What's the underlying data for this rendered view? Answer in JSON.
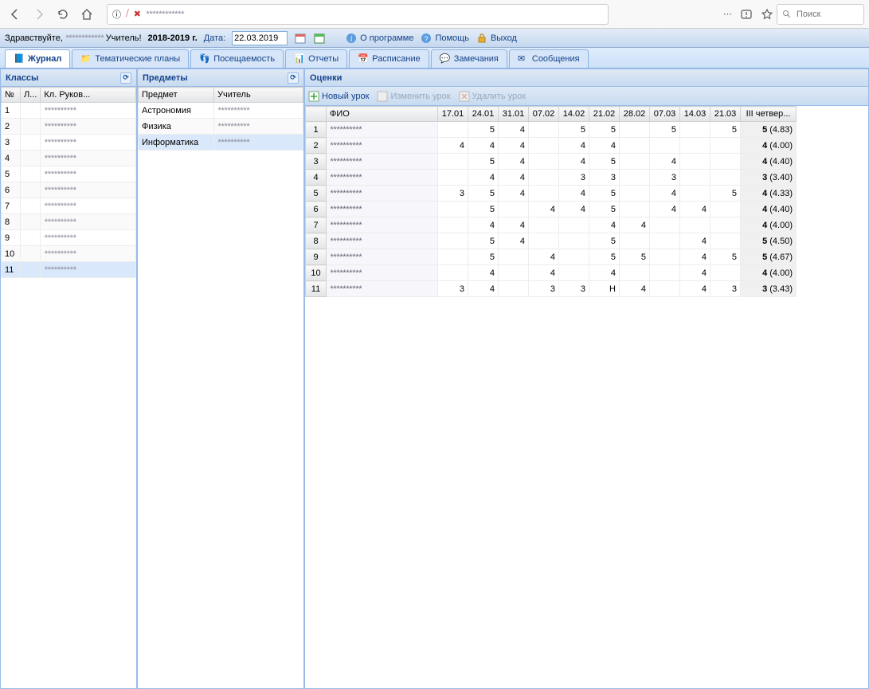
{
  "browser": {
    "search_placeholder": "Поиск",
    "url_display": "",
    "obscured_url": "************"
  },
  "header": {
    "greeting_prefix": "Здравствуйте, ",
    "greeting_obscured": "************",
    "role_suffix": "Учитель!",
    "year": "2018-2019 г.",
    "date_label": "Дата:",
    "date_value": "22.03.2019",
    "about": "О программе",
    "help": "Помощь",
    "exit": "Выход"
  },
  "tabs": [
    {
      "label": "Журнал",
      "active": true
    },
    {
      "label": "Тематические планы",
      "active": false
    },
    {
      "label": "Посещаемость",
      "active": false
    },
    {
      "label": "Отчеты",
      "active": false
    },
    {
      "label": "Расписание",
      "active": false
    },
    {
      "label": "Замечания",
      "active": false
    },
    {
      "label": "Сообщения",
      "active": false
    }
  ],
  "classes_panel": {
    "title": "Классы",
    "cols": [
      "№",
      "Л...",
      "Кл. Руков..."
    ],
    "rows": [
      {
        "n": "1",
        "l": "",
        "t": "**********"
      },
      {
        "n": "2",
        "l": "",
        "t": "**********"
      },
      {
        "n": "3",
        "l": "",
        "t": "**********"
      },
      {
        "n": "4",
        "l": "",
        "t": "**********"
      },
      {
        "n": "5",
        "l": "",
        "t": "**********"
      },
      {
        "n": "6",
        "l": "",
        "t": "**********"
      },
      {
        "n": "7",
        "l": "",
        "t": "**********"
      },
      {
        "n": "8",
        "l": "",
        "t": "**********"
      },
      {
        "n": "9",
        "l": "",
        "t": "**********"
      },
      {
        "n": "10",
        "l": "",
        "t": "**********"
      },
      {
        "n": "11",
        "l": "",
        "t": "**********"
      }
    ],
    "selected_index": 10
  },
  "subjects_panel": {
    "title": "Предметы",
    "cols": [
      "Предмет",
      "Учитель"
    ],
    "rows": [
      {
        "s": "Астрономия",
        "t": "**********"
      },
      {
        "s": "Физика",
        "t": "**********"
      },
      {
        "s": "Информатика",
        "t": "**********"
      }
    ],
    "selected_index": 2
  },
  "marks_panel": {
    "title": "Оценки",
    "toolbar": {
      "new": "Новый урок",
      "edit": "Изменить урок",
      "del": "Удалить урок"
    },
    "cols": [
      "",
      "ФИО",
      "17.01",
      "24.01",
      "31.01",
      "07.02",
      "14.02",
      "21.02",
      "28.02",
      "07.03",
      "14.03",
      "21.03",
      "III четвер..."
    ],
    "rows": [
      {
        "n": "1",
        "fio": "**********",
        "v": [
          "",
          "5",
          "4",
          "",
          "5",
          "5",
          "",
          "5",
          "",
          "5"
        ],
        "q": "5",
        "avg": "(4.83)"
      },
      {
        "n": "2",
        "fio": "**********",
        "v": [
          "4",
          "4",
          "4",
          "",
          "4",
          "4",
          "",
          "",
          "",
          ""
        ],
        "q": "4",
        "avg": "(4.00)"
      },
      {
        "n": "3",
        "fio": "**********",
        "v": [
          "",
          "5",
          "4",
          "",
          "4",
          "5",
          "",
          "4",
          "",
          ""
        ],
        "q": "4",
        "avg": "(4.40)"
      },
      {
        "n": "4",
        "fio": "**********",
        "v": [
          "",
          "4",
          "4",
          "",
          "3",
          "3",
          "",
          "3",
          "",
          ""
        ],
        "q": "3",
        "avg": "(3.40)"
      },
      {
        "n": "5",
        "fio": "**********",
        "v": [
          "3",
          "5",
          "4",
          "",
          "4",
          "5",
          "",
          "4",
          "",
          "5"
        ],
        "q": "4",
        "avg": "(4.33)"
      },
      {
        "n": "6",
        "fio": "**********",
        "v": [
          "",
          "5",
          "",
          "4",
          "4",
          "5",
          "",
          "4",
          "4",
          ""
        ],
        "q": "4",
        "avg": "(4.40)"
      },
      {
        "n": "7",
        "fio": "**********",
        "v": [
          "",
          "4",
          "4",
          "",
          "",
          "4",
          "4",
          "",
          "",
          ""
        ],
        "q": "4",
        "avg": "(4.00)"
      },
      {
        "n": "8",
        "fio": "**********",
        "v": [
          "",
          "5",
          "4",
          "",
          "",
          "5",
          "",
          "",
          "4",
          ""
        ],
        "q": "5",
        "avg": "(4.50)"
      },
      {
        "n": "9",
        "fio": "**********",
        "v": [
          "",
          "5",
          "",
          "4",
          "",
          "5",
          "5",
          "",
          "4",
          "5"
        ],
        "q": "5",
        "avg": "(4.67)"
      },
      {
        "n": "10",
        "fio": "**********",
        "v": [
          "",
          "4",
          "",
          "4",
          "",
          "4",
          "",
          "",
          "4",
          ""
        ],
        "q": "4",
        "avg": "(4.00)"
      },
      {
        "n": "11",
        "fio": "**********",
        "v": [
          "3",
          "4",
          "",
          "3",
          "3",
          "Н",
          "4",
          "",
          "4",
          "3"
        ],
        "q": "3",
        "avg": "(3.43)"
      }
    ]
  }
}
